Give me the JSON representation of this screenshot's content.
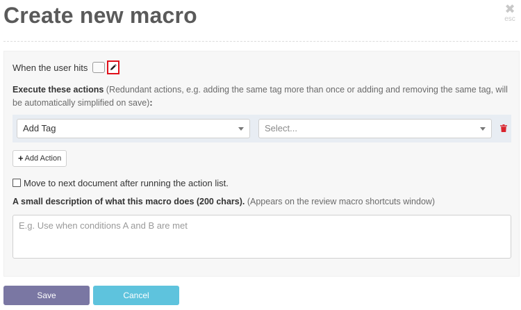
{
  "dialog": {
    "title": "Create new macro",
    "close_icon": "close-icon",
    "close_hint": "esc"
  },
  "trigger": {
    "label": "When the user hits",
    "key_value": "",
    "edit_icon": "pencil-icon"
  },
  "actions": {
    "heading_bold": "Execute these actions",
    "heading_note": " (Redundant actions, e.g. adding the same tag more than once or adding and removing the same tag, will be automatically simplified on save)",
    "heading_end": ":",
    "rows": [
      {
        "type_value": "Add Tag",
        "value_placeholder": "Select...",
        "delete_icon": "trash-icon"
      }
    ],
    "add_label": "Add Action",
    "add_icon": "plus-icon"
  },
  "move_next": {
    "label": "Move to next document after running the action list.",
    "checked": false
  },
  "description": {
    "heading_bold": "A small description of what this macro does (200 chars).",
    "heading_note": " (Appears on the review macro shortcuts window)",
    "placeholder": "E.g. Use when conditions A and B are met",
    "value": ""
  },
  "buttons": {
    "save_label": "Save",
    "cancel_label": "Cancel"
  },
  "colors": {
    "save": "#7a77a3",
    "cancel": "#5ec3dd",
    "highlight": "#e0101a",
    "trash": "#d9232d"
  }
}
